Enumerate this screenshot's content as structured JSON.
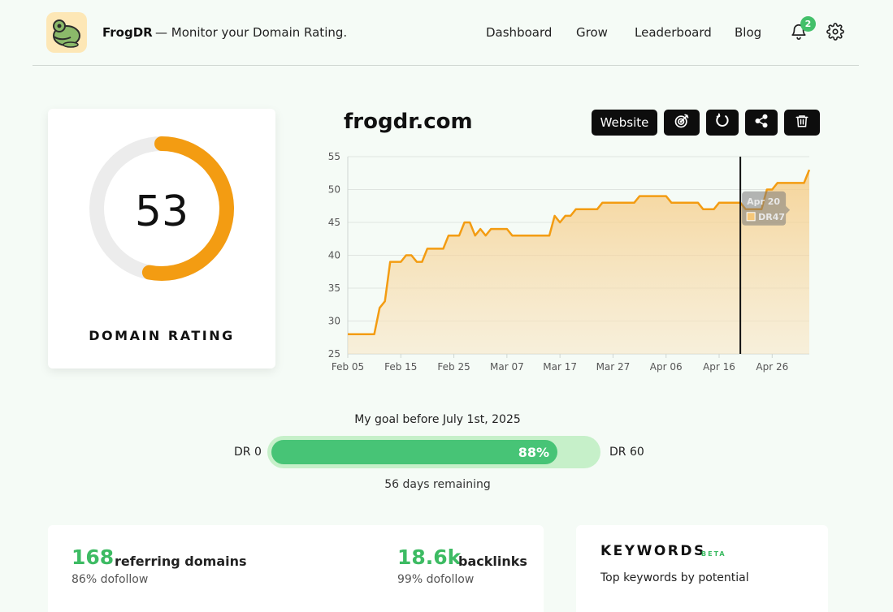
{
  "app": {
    "brand": "FrogDR",
    "tagline": "— Monitor your Domain Rating."
  },
  "nav": {
    "items": [
      "Dashboard",
      "Grow",
      "Leaderboard",
      "Blog"
    ],
    "notification_count": "2",
    "icons": [
      "bell-icon",
      "gear-icon"
    ]
  },
  "domain_rating": {
    "value": "53",
    "value_num": 53,
    "max": 100,
    "label": "DOMAIN RATING",
    "ring_color": "#f39c12",
    "track_color": "#ececec"
  },
  "site": {
    "title": "frogdr.com",
    "buttons": {
      "website": "Website",
      "icons": [
        "target-icon",
        "refresh-icon",
        "share-icon",
        "trash-icon"
      ]
    }
  },
  "chart_data": {
    "type": "area",
    "ylim": [
      25,
      55
    ],
    "yticks": [
      "55",
      "50",
      "45",
      "40",
      "35",
      "30",
      "25"
    ],
    "xtick_labels": [
      "Feb 05",
      "Feb 15",
      "Feb 25",
      "Mar 07",
      "Mar 17",
      "Mar 27",
      "Apr 06",
      "Apr 16",
      "Apr 26"
    ],
    "x_start": "Feb 05",
    "x_end": "May 03",
    "series": [
      {
        "color": "#f39c12",
        "points": [
          [
            "Feb 05",
            28
          ],
          [
            "Feb 10",
            28
          ],
          [
            "Feb 11",
            32
          ],
          [
            "Feb 12",
            33
          ],
          [
            "Feb 13",
            39
          ],
          [
            "Feb 15",
            39
          ],
          [
            "Feb 16",
            40
          ],
          [
            "Feb 17",
            40
          ],
          [
            "Feb 18",
            39
          ],
          [
            "Feb 19",
            39
          ],
          [
            "Feb 20",
            41
          ],
          [
            "Feb 23",
            41
          ],
          [
            "Feb 24",
            43
          ],
          [
            "Feb 26",
            43
          ],
          [
            "Feb 27",
            45
          ],
          [
            "Feb 28",
            45
          ],
          [
            "Mar 01",
            43
          ],
          [
            "Mar 02",
            44
          ],
          [
            "Mar 03",
            43
          ],
          [
            "Mar 04",
            44
          ],
          [
            "Mar 07",
            44
          ],
          [
            "Mar 08",
            43
          ],
          [
            "Mar 15",
            43
          ],
          [
            "Mar 16",
            46
          ],
          [
            "Mar 17",
            45
          ],
          [
            "Mar 18",
            46
          ],
          [
            "Mar 19",
            46
          ],
          [
            "Mar 20",
            47
          ],
          [
            "Mar 24",
            47
          ],
          [
            "Mar 25",
            48
          ],
          [
            "Mar 31",
            48
          ],
          [
            "Apr 01",
            49
          ],
          [
            "Apr 06",
            49
          ],
          [
            "Apr 07",
            48
          ],
          [
            "Apr 12",
            48
          ],
          [
            "Apr 13",
            47
          ],
          [
            "Apr 15",
            47
          ],
          [
            "Apr 16",
            48
          ],
          [
            "Apr 20",
            48
          ],
          [
            "Apr 21",
            47
          ],
          [
            "Apr 24",
            47
          ],
          [
            "Apr 25",
            50
          ],
          [
            "Apr 26",
            50
          ],
          [
            "Apr 27",
            51
          ],
          [
            "May 02",
            51
          ],
          [
            "May 03",
            53
          ]
        ]
      }
    ],
    "tooltip": {
      "date": "Apr 20",
      "value_label": "DR47"
    },
    "grid": true,
    "marker_line": "Apr 20"
  },
  "goal": {
    "title": "My goal before July 1st, 2025",
    "min_label": "DR 0",
    "max_label": "DR 60",
    "progress": 0.88,
    "progress_label": "88%",
    "remaining": "56 days remaining"
  },
  "stats": {
    "referring_domains": {
      "value": "168",
      "label": "referring domains",
      "sub": "86% dofollow"
    },
    "backlinks": {
      "value": "18.6k",
      "label": "backlinks",
      "sub": "99% dofollow"
    }
  },
  "keywords": {
    "title": "KEYWORDS",
    "badge": "BETA",
    "subtitle": "Top keywords by potential"
  }
}
